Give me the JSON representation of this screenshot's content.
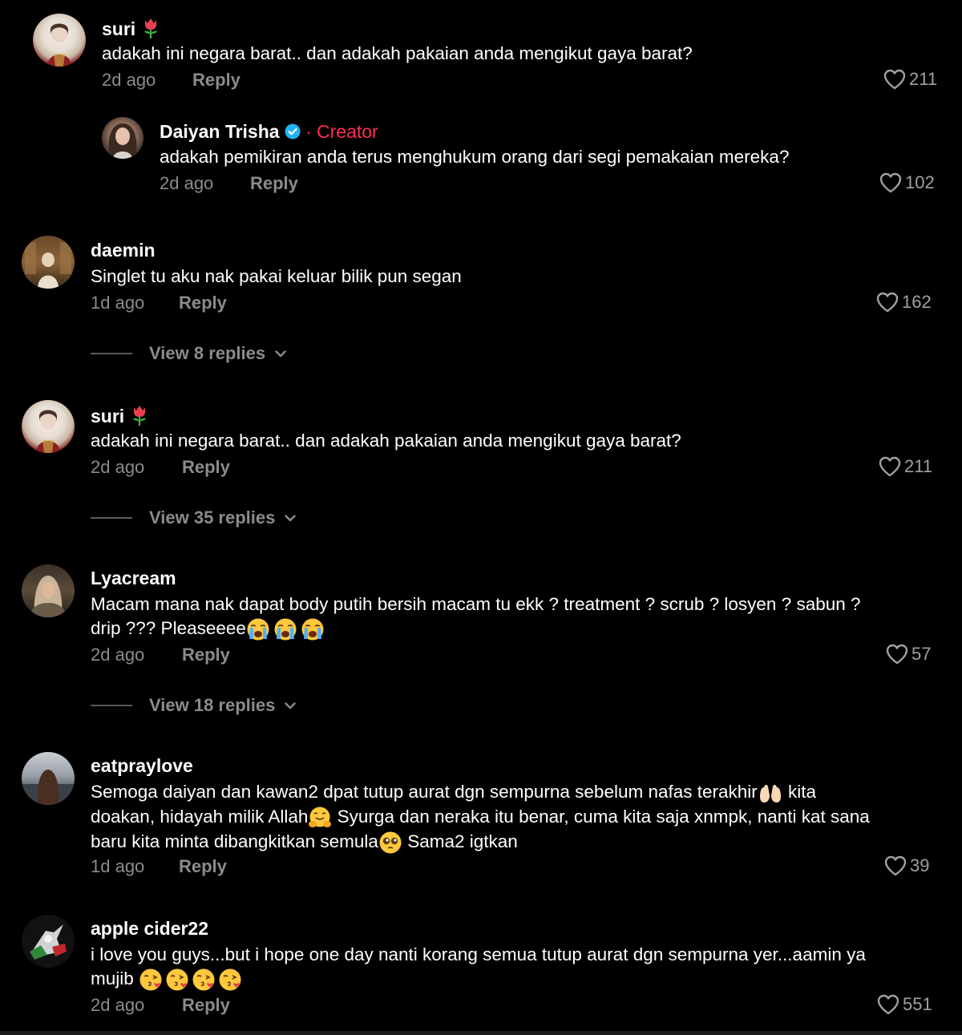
{
  "comments": [
    {
      "username": "suri",
      "emoji_after_name": "tulip",
      "text": "adakah ini negara barat.. dan adakah pakaian anda mengikut gaya barat?",
      "time": "2d ago",
      "reply_label": "Reply",
      "likes": "211"
    },
    {
      "username": "Daiyan Trisha",
      "verified": true,
      "creator_label": "· Creator",
      "text": "adakah pemikiran anda terus menghukum orang dari segi pemakaian mereka?",
      "time": "2d ago",
      "reply_label": "Reply",
      "likes": "102"
    },
    {
      "username": "daemin",
      "text": "Singlet tu aku nak pakai keluar bilik pun segan",
      "time": "1d ago",
      "reply_label": "Reply",
      "likes": "162",
      "view_replies": "View 8 replies"
    },
    {
      "username": "suri",
      "emoji_after_name": "tulip",
      "text": "adakah ini negara barat.. dan adakah pakaian anda mengikut gaya barat?",
      "time": "2d ago",
      "reply_label": "Reply",
      "likes": "211",
      "view_replies": "View 35 replies"
    },
    {
      "username": "Lyacream",
      "text_line1": "Macam mana nak dapat body putih bersih macam tu ekk ? treatment ? scrub ? losyen ? sabun ?",
      "text_line2": "drip ??? Pleaseeee",
      "emojis": [
        "loudly-crying-face",
        "loudly-crying-face",
        "loudly-crying-face"
      ],
      "time": "2d ago",
      "reply_label": "Reply",
      "likes": "57",
      "view_replies": "View 18 replies"
    },
    {
      "username": "eatpraylove",
      "text_line1a": "Semoga daiyan dan kawan2 dpat tutup aurat dgn sempurna sebelum nafas terakhir",
      "text_line1b": " kita",
      "text_line2a": "doakan, hidayah milik Allah",
      "text_line2b": " Syurga dan neraka itu benar, cuma kita saja xnmpk, nanti kat sana",
      "text_line3a": "baru kita minta dibangkitkan semula",
      "text_line3b": " Sama2 igtkan",
      "time": "1d ago",
      "reply_label": "Reply",
      "likes": "39"
    },
    {
      "username": "apple cider22",
      "text_line1": "i love you guys...but i hope one day nanti korang semua tutup aurat dgn sempurna yer...aamin ya",
      "text_line2": "mujib",
      "emojis": [
        "face-blowing-kiss",
        "face-blowing-kiss",
        "face-blowing-kiss",
        "face-blowing-kiss"
      ],
      "time": "2d ago",
      "reply_label": "Reply",
      "likes": "551"
    }
  ],
  "colors": {
    "background": "#000000",
    "text": "#ffffff",
    "meta": "#8b8b8b",
    "creator": "#fe2c55",
    "verified": "#20b3f4"
  }
}
